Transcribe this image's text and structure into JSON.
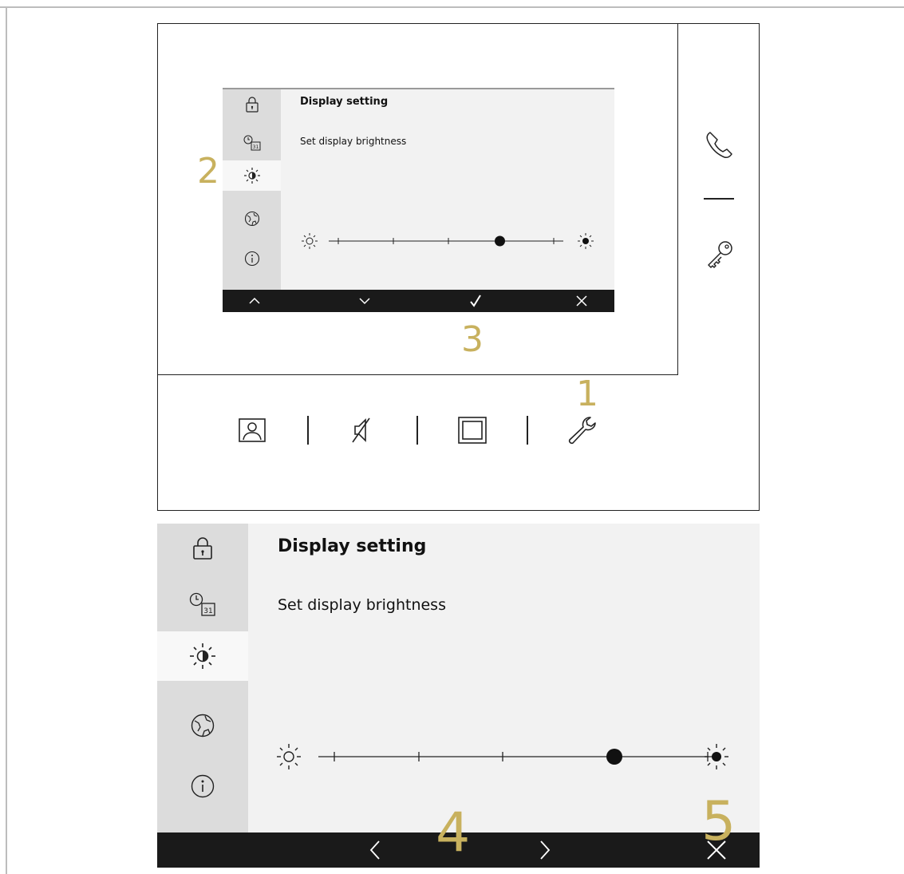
{
  "callouts": {
    "c1": "1",
    "c2": "2",
    "c3": "3",
    "c4": "4",
    "c5": "5"
  },
  "small_screen": {
    "title": "Display setting",
    "subtitle": "Set display brightness",
    "sidebar": [
      {
        "icon": "lock-icon"
      },
      {
        "icon": "clock-calendar-icon",
        "calendar_text": "31"
      },
      {
        "icon": "brightness-icon",
        "active": true
      },
      {
        "icon": "globe-icon"
      },
      {
        "icon": "info-icon"
      }
    ],
    "brightness_level": 0.75,
    "bar": [
      "chevron-up-icon",
      "chevron-down-icon",
      "check-icon",
      "close-icon"
    ]
  },
  "device_buttons": [
    "phone-icon",
    "divider",
    "key-icon"
  ],
  "device_bottom_buttons": [
    "contact-portrait-icon",
    "mute-icon",
    "fullscreen-icon",
    "wrench-icon"
  ],
  "big_screen": {
    "title": "Display setting",
    "subtitle": "Set display brightness",
    "sidebar": [
      {
        "icon": "lock-icon"
      },
      {
        "icon": "clock-calendar-icon",
        "calendar_text": "31"
      },
      {
        "icon": "brightness-icon",
        "active": true
      },
      {
        "icon": "globe-icon"
      },
      {
        "icon": "info-icon"
      }
    ],
    "brightness_level": 0.75,
    "bar": [
      "chevron-left-icon",
      "chevron-right-icon",
      "close-icon"
    ]
  },
  "colors": {
    "callout": "#c8b15e",
    "bar": "#1a1a1a",
    "sidebar": "#dcdcdc",
    "panel": "#f2f2f2"
  }
}
